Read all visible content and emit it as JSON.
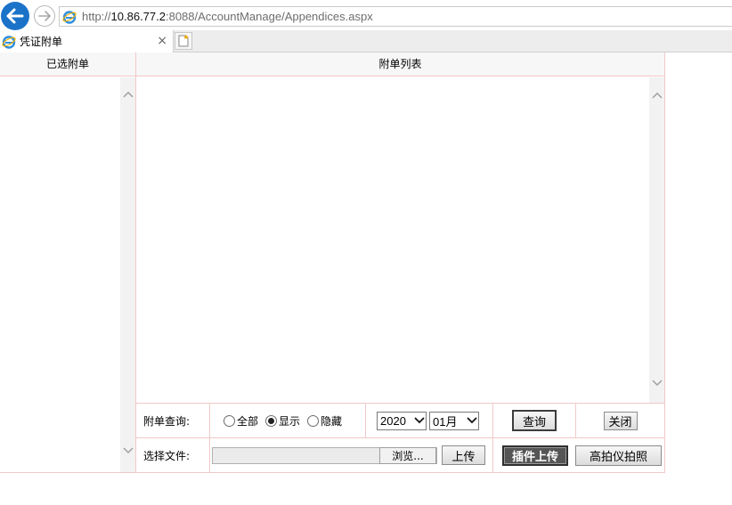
{
  "browser": {
    "url_prefix": "http://",
    "url_host": "10.86.77.2",
    "url_rest": ":8088/AccountManage/Appendices.aspx",
    "tab_title": "凭证附单",
    "tab_close": "×"
  },
  "left_panel": {
    "header": "已选附单"
  },
  "right_panel": {
    "header": "附单列表"
  },
  "query_row": {
    "label": "附单查询:",
    "radios": [
      {
        "label": "全部",
        "checked": false
      },
      {
        "label": "显示",
        "checked": true
      },
      {
        "label": "隐藏",
        "checked": false
      }
    ],
    "year": "2020",
    "month": "01月",
    "query_button": "查询",
    "close_button": "关闭"
  },
  "upload_row": {
    "label": "选择文件:",
    "browse_button": "浏览...",
    "upload_button": "上传",
    "plugin_upload_button": "插件上传",
    "camera_button": "高拍仪拍照"
  },
  "colors": {
    "border": "#f2c8c8",
    "back_button": "#1a73c9",
    "plugin_button": "#555555"
  },
  "icons": {
    "back": "arrow-left-icon",
    "forward": "arrow-right-icon",
    "browser": "ie-logo-icon",
    "new_tab": "new-tab-icon",
    "scroll_up": "chevron-up-icon",
    "scroll_down": "chevron-down-icon",
    "select_caret": "chevron-down-icon"
  }
}
